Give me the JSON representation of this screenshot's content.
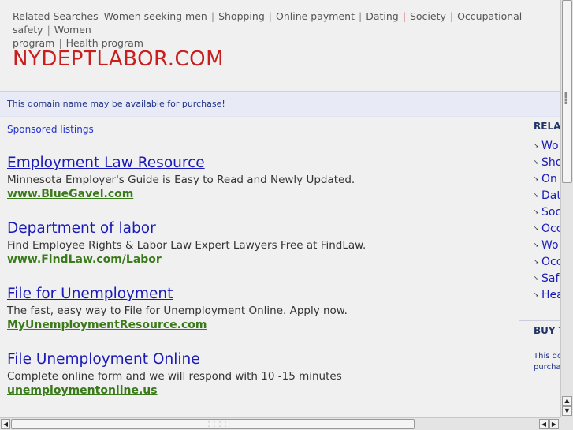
{
  "related_top": {
    "lead": "Related Searches",
    "items": [
      "Women seeking men",
      "Shopping",
      "Online payment",
      "Dating",
      "Society",
      "Occupational safety",
      "Women",
      "program",
      "Health program"
    ]
  },
  "site_title": "NYDEPTLABOR.COM",
  "notice": "This domain name may be available for purchase!",
  "sponsored_label": "Sponsored listings",
  "listings": [
    {
      "title": "Employment Law Resource",
      "desc": "Minnesota Employer's Guide is Easy to Read and Newly Updated.",
      "url": "www.BlueGavel.com"
    },
    {
      "title": "Department of labor",
      "desc": "Find Employee Rights & Labor Law Expert Lawyers Free at FindLaw.",
      "url": "www.FindLaw.com/Labor"
    },
    {
      "title": "File for Unemployment",
      "desc": "The fast, easy way to File for Unemployment Online. Apply now.",
      "url": "MyUnemploymentResource.com"
    },
    {
      "title": "File Unemployment Online",
      "desc": "Complete online form and we will respond with 10 -15 minutes",
      "url": "unemploymentonline.us"
    }
  ],
  "sidebar": {
    "heading": "RELA",
    "items": [
      "Wo",
      "Sho",
      "On",
      "Dat",
      "Soc",
      "Occ",
      "Wo",
      "Occ",
      "Saf",
      "Hea"
    ],
    "buy_heading": "BUY T",
    "buy_text": "This do purcha"
  },
  "colors": {
    "title": "#c81e1e",
    "link": "#1a1ab8",
    "url": "#3a7a1a",
    "notice_bg": "#e8ebf5"
  }
}
